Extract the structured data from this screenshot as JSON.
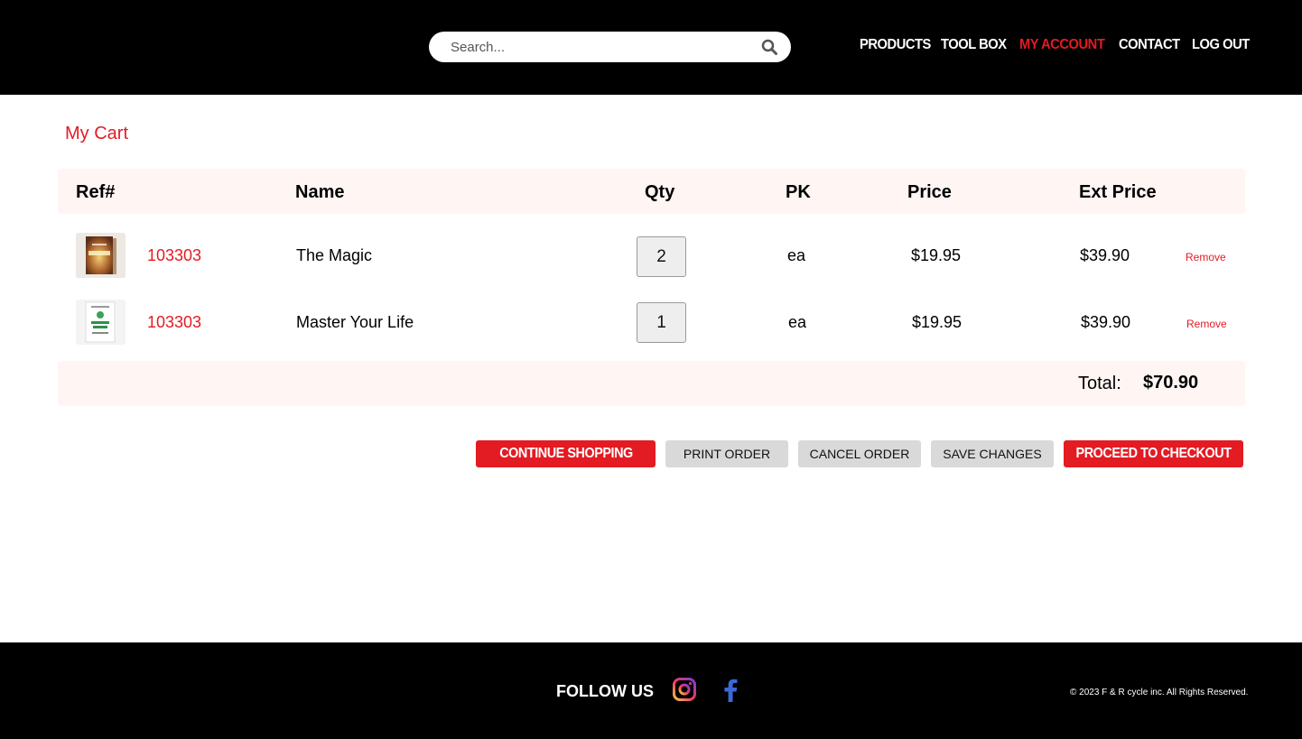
{
  "header": {
    "search_placeholder": "Search...",
    "nav": [
      "PRODUCTS",
      "TOOL BOX",
      "MY ACCOUNT",
      "CONTACT",
      "LOG OUT"
    ],
    "active_nav": "MY ACCOUNT"
  },
  "page": {
    "title": "My Cart"
  },
  "table": {
    "headers": {
      "ref": "Ref#",
      "name": "Name",
      "qty": "Qty",
      "pk": "PK",
      "price": "Price",
      "ext_price": "Ext Price"
    },
    "rows": [
      {
        "ref": "103303",
        "name": "The Magic",
        "qty": "2",
        "pk": "ea",
        "price": "$19.95",
        "ext_price": "$39.90",
        "remove": "Remove",
        "thumb_icon": "book-cover-the-magic"
      },
      {
        "ref": "103303",
        "name": "Master Your Life",
        "qty": "1",
        "pk": "ea",
        "price": "$19.95",
        "ext_price": "$39.90",
        "remove": "Remove",
        "thumb_icon": "book-cover-master-your-life"
      }
    ]
  },
  "totals": {
    "label": "Total:",
    "value": "$70.90"
  },
  "actions": {
    "continue_shopping": "CONTINUE SHOPPING",
    "print_order": "PRINT ORDER",
    "cancel_order": "CANCEL ORDER",
    "save_changes": "SAVE CHANGES",
    "proceed_to_checkout": "PROCEED TO CHECKOUT"
  },
  "footer": {
    "follow_us": "FOLLOW US",
    "copyright": "© 2023 F & R cycle inc. All Rights Reserved."
  },
  "colors": {
    "accent": "#e31b23",
    "header_bg": "#000000",
    "row_highlight": "#fff5f3",
    "button_grey": "#d9d9d9"
  }
}
